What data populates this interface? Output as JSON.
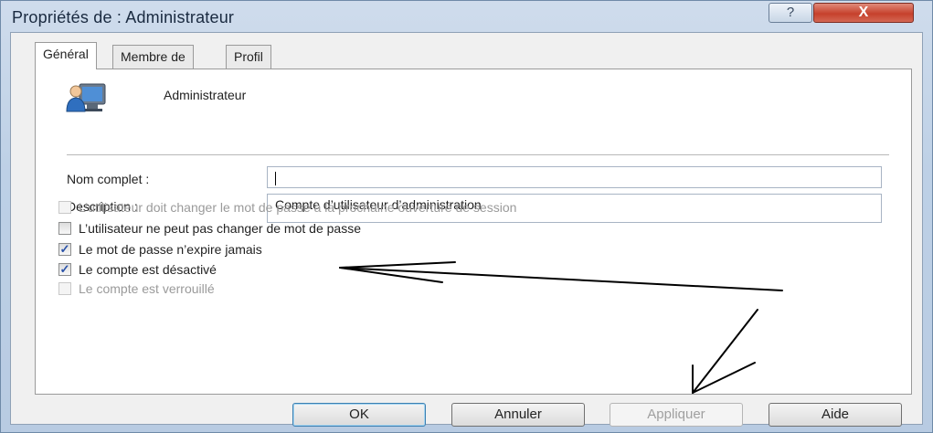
{
  "window": {
    "title": "Propriétés de : Administrateur",
    "help_label": "?",
    "close_label": "X"
  },
  "tabs": [
    {
      "label": "Général",
      "active": true
    },
    {
      "label": "Membre de",
      "active": false
    },
    {
      "label": "Profil",
      "active": false
    }
  ],
  "user": {
    "name": "Administrateur",
    "icon": "user-monitor-icon"
  },
  "fields": {
    "full_name_label": "Nom complet :",
    "full_name_value": "",
    "description_label": "Description :",
    "description_value": "Compte d’utilisateur d’administration"
  },
  "checkboxes": [
    {
      "label": "L’utilisateur doit changer le mot de passe à la prochaine ouverture de session",
      "checked": false,
      "enabled": false
    },
    {
      "label": "L’utilisateur ne peut pas changer de mot de passe",
      "checked": false,
      "enabled": true
    },
    {
      "label": "Le mot de passe n’expire jamais",
      "checked": true,
      "enabled": true
    },
    {
      "label": "Le compte est désactivé",
      "checked": true,
      "enabled": true
    },
    {
      "label": "Le compte est verrouillé",
      "checked": false,
      "enabled": false
    }
  ],
  "buttons": {
    "ok": "OK",
    "cancel": "Annuler",
    "apply": "Appliquer",
    "help": "Aide"
  },
  "colors": {
    "annotation": "#000000",
    "close_button": "#c6412c",
    "check_mark": "#2a52a8"
  }
}
